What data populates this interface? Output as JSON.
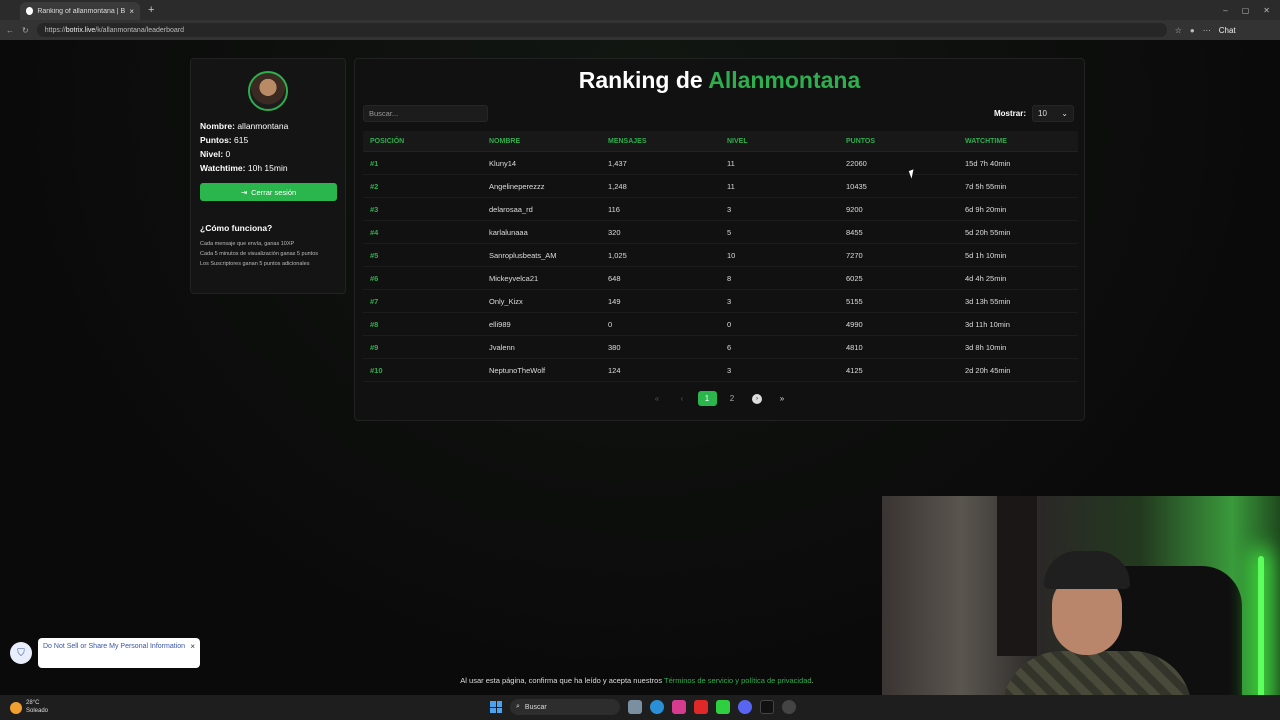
{
  "browser": {
    "tab_title": "Ranking of allanmontana | BotRix",
    "url_prefix": "https://",
    "url_host": "botrix.live",
    "url_path": "/k/allanmontana/leaderboard",
    "chat_label": "Chat"
  },
  "profile": {
    "name_key": "Nombre:",
    "name_val": "allanmontana",
    "points_key": "Puntos:",
    "points_val": "615",
    "level_key": "Nivel:",
    "level_val": "0",
    "watch_key": "Watchtime:",
    "watch_val": "10h 15min",
    "logout_label": "Cerrar sesión",
    "how_title": "¿Cómo funciona?",
    "how_lines": [
      "Cada mensaje que envía, ganas 10XP",
      "Cada 5 minutos de visualización ganas 5 puntos",
      "Los Suscriptores ganan 5 puntos adicionales"
    ]
  },
  "ranking": {
    "title_prefix": "Ranking de ",
    "title_name": "Allanmontana",
    "search_placeholder": "Buscar...",
    "show_label": "Mostrar:",
    "show_value": "10",
    "headers": [
      "POSICIÓN",
      "NOMBRE",
      "MENSAJES",
      "NIVEL",
      "PUNTOS",
      "WATCHTIME"
    ],
    "rows": [
      [
        "#1",
        "Kluny14",
        "1,437",
        "11",
        "22060",
        "15d 7h 40min"
      ],
      [
        "#2",
        "Angelineperezzz",
        "1,248",
        "11",
        "10435",
        "7d 5h 55min"
      ],
      [
        "#3",
        "delarosaa_rd",
        "116",
        "3",
        "9200",
        "6d 9h 20min"
      ],
      [
        "#4",
        "karlalunaaa",
        "320",
        "5",
        "8455",
        "5d 20h 55min"
      ],
      [
        "#5",
        "Sanroplusbeats_AM",
        "1,025",
        "10",
        "7270",
        "5d 1h 10min"
      ],
      [
        "#6",
        "Mickeyvelca21",
        "648",
        "8",
        "6025",
        "4d 4h 25min"
      ],
      [
        "#7",
        "Only_Kizx",
        "149",
        "3",
        "5155",
        "3d 13h 55min"
      ],
      [
        "#8",
        "elli989",
        "0",
        "0",
        "4990",
        "3d 11h 10min"
      ],
      [
        "#9",
        "Jvalenn",
        "380",
        "6",
        "4810",
        "3d 8h 10min"
      ],
      [
        "#10",
        "NeptunoTheWolf",
        "124",
        "3",
        "4125",
        "2d 20h 45min"
      ]
    ],
    "pager": {
      "first": "«",
      "prev": "‹",
      "page1": "1",
      "page2": "2",
      "next": "›",
      "last": "»"
    }
  },
  "footer": {
    "text": "Al usar esta página, confirma que ha leído y acepta nuestros ",
    "link": "Términos de servicio y política de privacidad",
    "end": "."
  },
  "privacy": {
    "text": "Do Not Sell or Share My Personal Information"
  },
  "taskbar": {
    "temp": "28°C",
    "weather": "Soleado",
    "search": "Buscar"
  },
  "colors": {
    "accent": "#2fae4e"
  }
}
